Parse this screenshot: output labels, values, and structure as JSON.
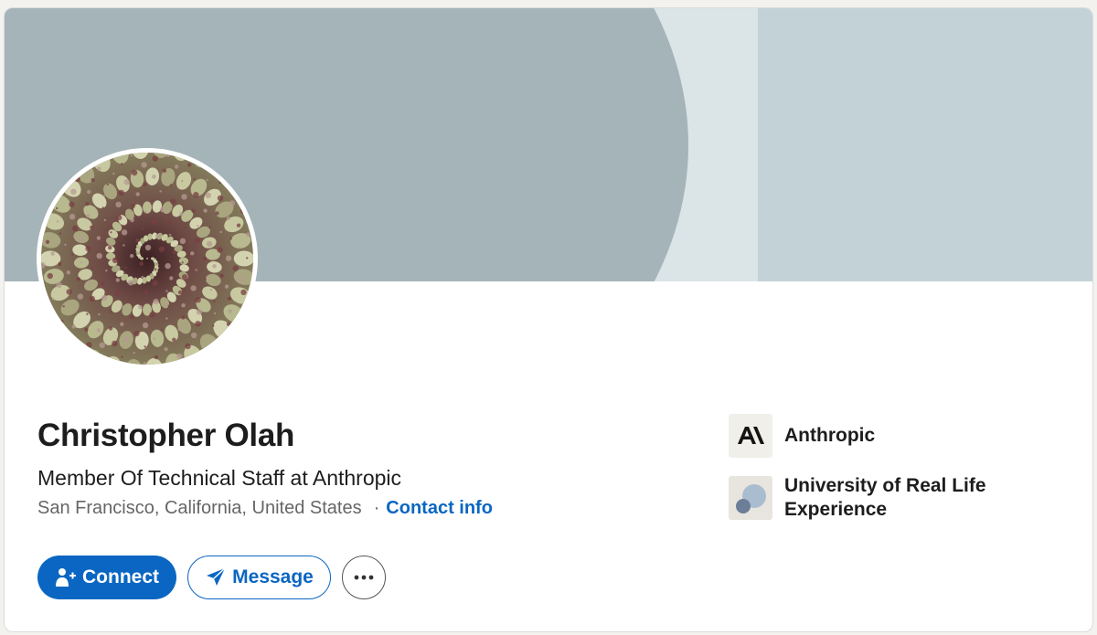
{
  "profile": {
    "name": "Christopher Olah",
    "headline": "Member Of Technical Staff at Anthropic",
    "location": "San Francisco, California, United States",
    "separator": "·",
    "contact_info_label": "Contact info"
  },
  "actions": {
    "connect_label": "Connect",
    "message_label": "Message",
    "more_icon": "more-horizontal-icon"
  },
  "organizations": [
    {
      "name": "Anthropic",
      "logo_icon": "anthropic-logo"
    },
    {
      "name": "University of Real Life Experience",
      "logo_icon": "university-logo"
    }
  ],
  "colors": {
    "brand_blue": "#0a66c2",
    "banner_dark": "#a5b4b8",
    "banner_light": "#dbe4e7",
    "banner_right": "#c3d2d7"
  }
}
